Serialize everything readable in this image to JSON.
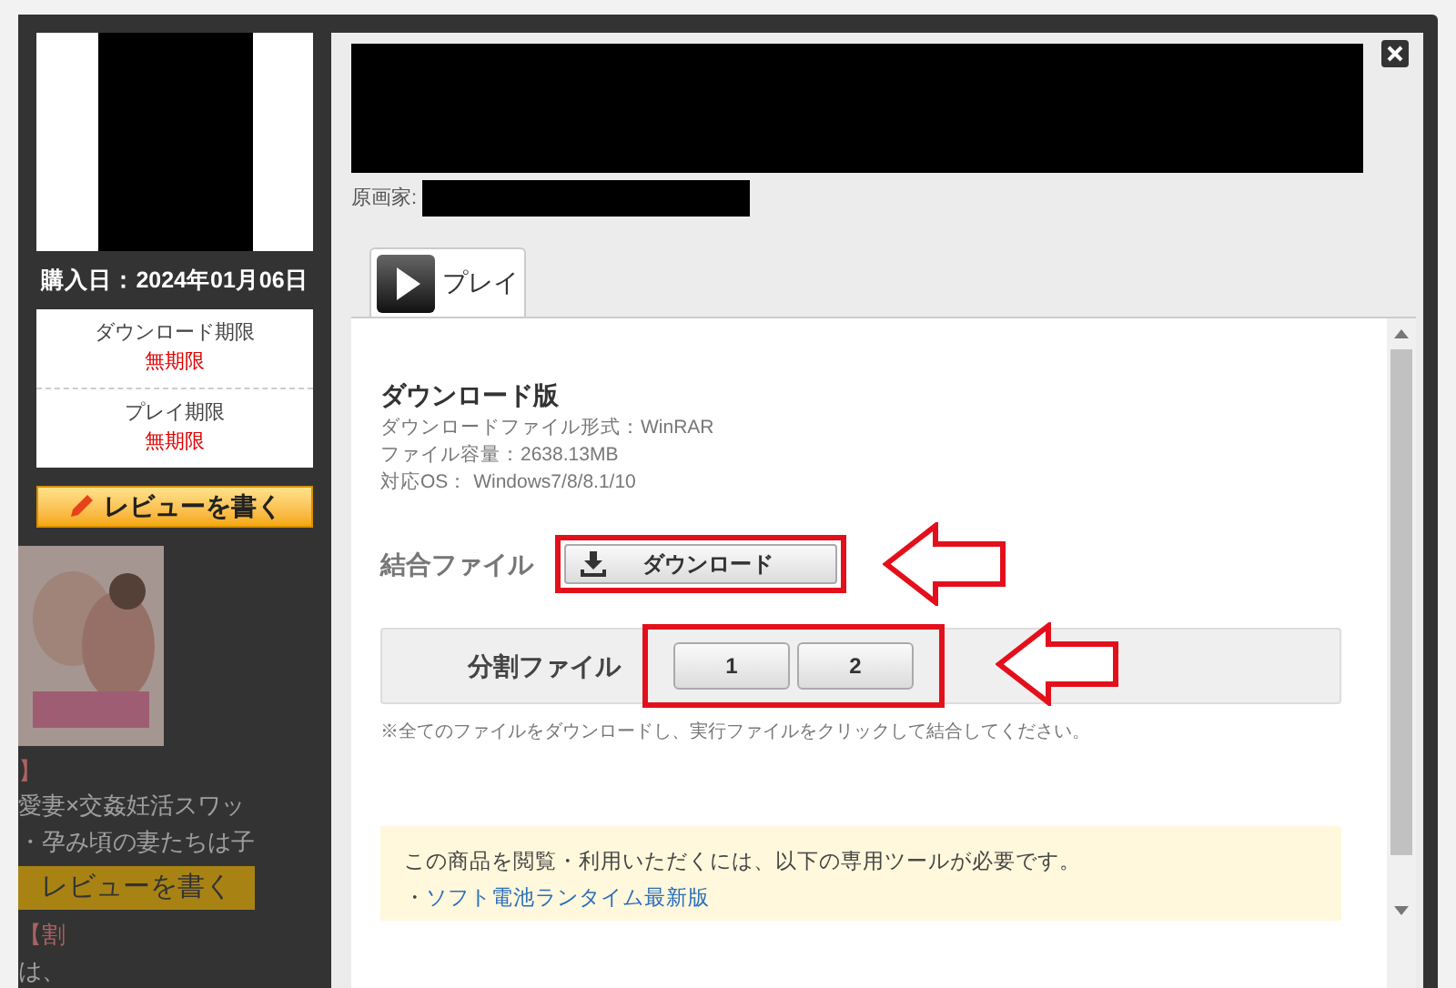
{
  "sidebar": {
    "purchase_date": "購入日：2024年01月06日",
    "limits": [
      {
        "label": "ダウンロード期限",
        "value": "無期限"
      },
      {
        "label": "プレイ期限",
        "value": "無期限"
      }
    ],
    "review_button": "レビューを書く"
  },
  "background_page": {
    "items": [
      {
        "mark": "】",
        "lines": [
          "愛妻×交姦妊活スワッ",
          "・孕み頃の妻たちは子"
        ],
        "button": "レビューを書く"
      },
      {
        "mark": "【割",
        "lines": [
          "は、"
        ]
      }
    ]
  },
  "product": {
    "artist_label": "原画家:",
    "tabs": [
      {
        "label": "プレイ",
        "selected": true
      }
    ],
    "heading": "ダウンロード版",
    "specs": [
      "ダウンロードファイル形式：WinRAR",
      "ファイル容量：2638.13MB",
      "対応OS： Windows7/8/8.1/10"
    ],
    "combined": {
      "label": "結合ファイル",
      "button": "ダウンロード",
      "highlighted": true
    },
    "split": {
      "label": "分割ファイル",
      "parts": [
        "1",
        "2"
      ],
      "highlighted": true
    },
    "note": "※全てのファイルをダウンロードし、実行ファイルをクリックして結合してください。",
    "tools": {
      "text": "この商品を閲覧・利用いただくには、以下の専用ツールが必要です。",
      "bullet": "・",
      "link": "ソフト電池ランタイム最新版"
    }
  }
}
